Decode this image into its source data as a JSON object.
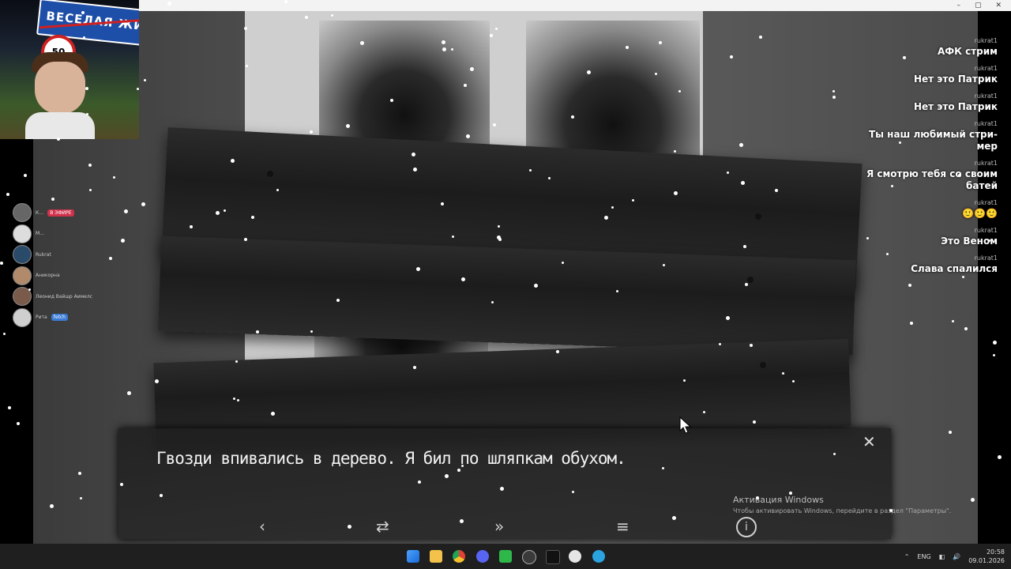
{
  "webcam": {
    "road_sign_text": "ВЕСЕЛАЯ ЖИЗ",
    "speed_limit": "50"
  },
  "window_controls": [
    "–",
    "▢",
    "✕"
  ],
  "voice_panel": {
    "users": [
      {
        "name": "К…",
        "tag": "В ЭФИРЕ"
      },
      {
        "name": "M…",
        "tag": ""
      },
      {
        "name": "Rukrat",
        "tag": ""
      },
      {
        "name": "Аникорна",
        "tag": ""
      },
      {
        "name": "Леонид Вайшр Аимелс",
        "tag": ""
      },
      {
        "name": "Рита",
        "tag": "fetch"
      }
    ]
  },
  "chat": {
    "messages": [
      {
        "user": "rukrat1",
        "text": "АФК стрим"
      },
      {
        "user": "rukrat1",
        "text": "Нет это Патрик"
      },
      {
        "user": "rukrat1",
        "text": "Нет это Патрик"
      },
      {
        "user": "rukrat1",
        "text": "Ты наш любимый стри- мер"
      },
      {
        "user": "rukrat1",
        "text": "Я смотрю тебя со своим батей"
      },
      {
        "user": "rukrat1",
        "text": ""
      },
      {
        "user": "rukrat1",
        "text": "Это Веном"
      },
      {
        "user": "rukrat1",
        "text": "Слава спалился"
      }
    ]
  },
  "dialog": {
    "text": "Гвозди впивались в дерево. Я бил по шляпкам обухом.",
    "controls": {
      "back": "‹",
      "skip": "»",
      "auto": "⇄",
      "menu": "≡",
      "info": "i",
      "close": "✕"
    }
  },
  "activation": {
    "title": "Активация Windows",
    "subtitle": "Чтобы активировать Windows, перейдите в раздел \"Параметры\"."
  },
  "taskbar": {
    "language": "ENG",
    "time": "20:58",
    "date": "09.01.2026"
  }
}
